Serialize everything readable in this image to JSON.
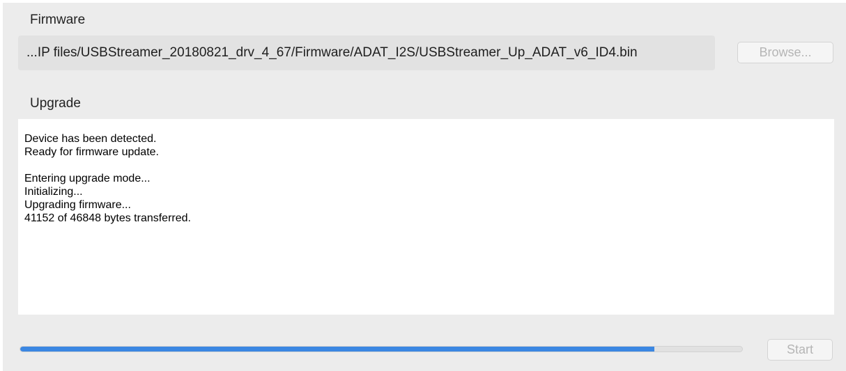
{
  "firmware": {
    "section_label": "Firmware",
    "path_value": "...IP files/USBStreamer_20180821_drv_4_67/Firmware/ADAT_I2S/USBStreamer_Up_ADAT_v6_ID4.bin",
    "browse_label": "Browse...",
    "browse_enabled": false
  },
  "upgrade": {
    "section_label": "Upgrade",
    "log_lines": [
      "Device has been detected.",
      "Ready for firmware update.",
      "",
      "Entering upgrade mode...",
      "Initializing...",
      "Upgrading firmware...",
      "41152 of 46848 bytes transferred."
    ]
  },
  "progress": {
    "fraction": 0.878
  },
  "controls": {
    "start_label": "Start",
    "start_enabled": false
  },
  "colors": {
    "progress_fill": "#3b87e2",
    "window_background": "#ececec",
    "disabled_text": "#b5b5b5"
  }
}
